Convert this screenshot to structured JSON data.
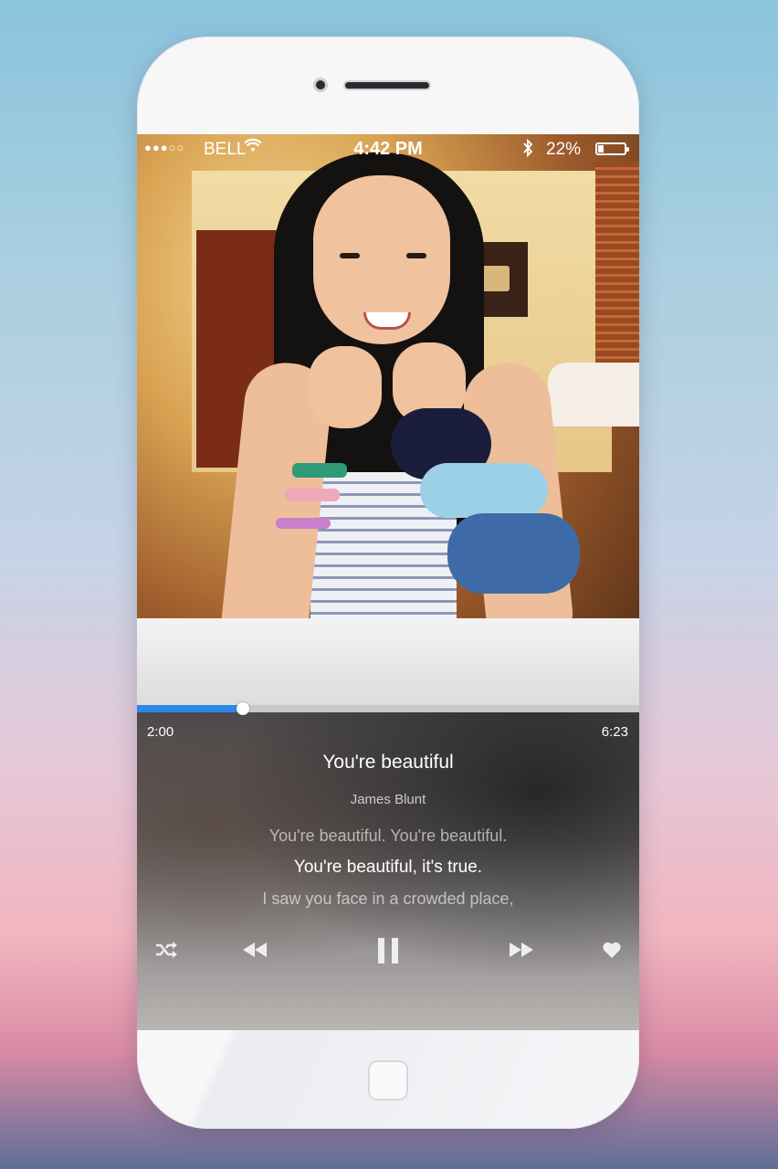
{
  "status_bar": {
    "signal": "●●●○○",
    "carrier": "BELL",
    "time": "4:42 PM",
    "battery_pct": "22%",
    "battery_level": 0.22,
    "wifi_icon": "wifi-icon",
    "bluetooth_icon": "bluetooth-icon"
  },
  "player": {
    "elapsed": "2:00",
    "duration": "6:23",
    "progress": 0.21,
    "song_title": "You're beautiful",
    "artist": "James Blunt",
    "lyrics": [
      "You're beautiful. You're beautiful.",
      "You're beautiful, it's true.",
      "I saw you face in a crowded place,"
    ],
    "current_lyric_index": 1,
    "controls": [
      "shuffle-icon",
      "rewind-icon",
      "pause-icon",
      "fast-forward-icon",
      "heart-icon"
    ]
  },
  "colors": {
    "accent": "#2b8ae6",
    "phone_body": "#f7f7f8"
  }
}
